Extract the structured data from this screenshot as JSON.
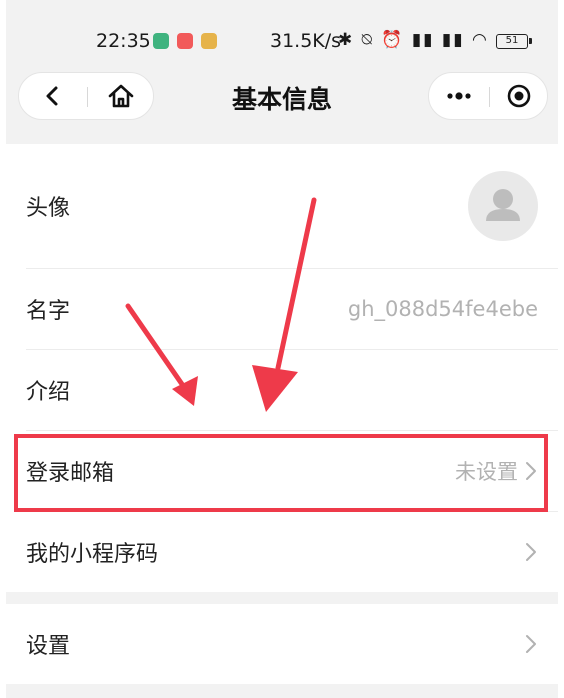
{
  "status_bar": {
    "time": "22:35",
    "network_speed": "31.5K/s",
    "indicators": "✱ ⍉ ⏰ ▮▮ ▮▮ ◠",
    "battery": "51"
  },
  "nav": {
    "title": "基本信息",
    "back_icon": "chevron-left-icon",
    "home_icon": "home-icon",
    "more_icon": "more-dots-icon",
    "close_icon": "target-circle-icon"
  },
  "profile": {
    "avatar_label": "头像",
    "name_label": "名字",
    "name_value": "gh_088d54fe4ebe",
    "intro_label": "介绍",
    "email_label": "登录邮箱",
    "email_value": "未设置",
    "qrcode_label": "我的小程序码"
  },
  "settings": {
    "label": "设置"
  },
  "colors": {
    "highlight": "#ee3a4a",
    "page_bg": "#f2f2f2",
    "muted_text": "#b2b2b2"
  }
}
